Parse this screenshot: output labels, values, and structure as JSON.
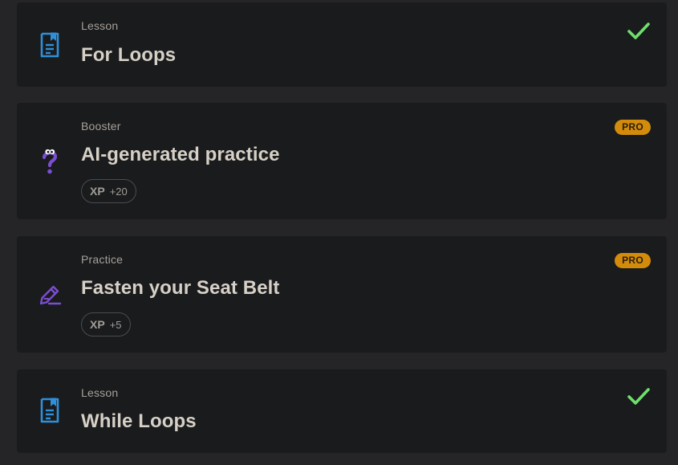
{
  "items": [
    {
      "category": "Lesson",
      "title": "For Loops",
      "icon": "lesson-document-icon",
      "status": "completed"
    },
    {
      "category": "Booster",
      "title": "AI-generated practice",
      "icon": "question-mark-icon",
      "badge": "PRO",
      "xp_label": "XP",
      "xp_value": "+20"
    },
    {
      "category": "Practice",
      "title": "Fasten your Seat Belt",
      "icon": "pencil-icon",
      "badge": "PRO",
      "xp_label": "XP",
      "xp_value": "+5"
    },
    {
      "category": "Lesson",
      "title": "While Loops",
      "icon": "lesson-document-icon",
      "status": "completed"
    }
  ],
  "colors": {
    "page_bg": "#252527",
    "card_bg": "#1a1b1d",
    "lesson_icon": "#2f8fd8",
    "practice_icon": "#7b4ed0",
    "check": "#6ee06a",
    "pro_badge": "#d38b0b"
  }
}
